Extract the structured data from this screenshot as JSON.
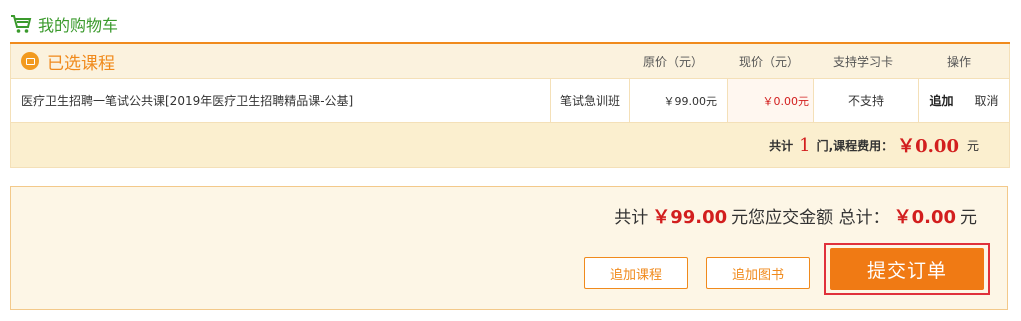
{
  "header": {
    "title": "我的购物车",
    "icon": "shopping-cart-icon"
  },
  "table": {
    "section_title": "已选课程",
    "columns": {
      "original_price": "原价（元）",
      "current_price": "现价（元）",
      "study_card": "支持学习卡",
      "operation": "操作"
    },
    "rows": [
      {
        "name": "医疗卫生招聘一笔试公共课[2019年医疗卫生招聘精品课-公基]",
        "type": "笔试急训班",
        "original_price": "￥99.00元",
        "current_price": "￥0.00元",
        "study_card": "不支持",
        "add_label": "追加",
        "cancel_label": "取消"
      }
    ],
    "footer": {
      "prefix": "共计",
      "count": "1",
      "mid": "门,课程费用：",
      "fee": "￥0.00",
      "unit": "元"
    }
  },
  "summary": {
    "prefix": "共计",
    "total": "￥99.00",
    "mid": "元您应交金额 总计：",
    "payable": "￥0.00",
    "unit": "元"
  },
  "buttons": {
    "add_course": "追加课程",
    "add_book": "追加图书",
    "submit": "提交订单"
  },
  "colors": {
    "accent": "#f08a1c",
    "price_red": "#d21e1e",
    "header_green": "#3a9a2c",
    "submit_bg": "#f07a14",
    "highlight_border": "#e0313b"
  }
}
